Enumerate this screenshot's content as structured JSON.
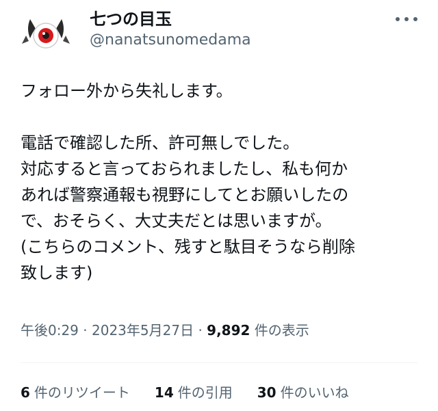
{
  "author": {
    "display_name": "七つの目玉",
    "handle": "@nanatsunomedama",
    "avatar_icon": "red-eyeball-with-horns-icon"
  },
  "tweet": {
    "lines": [
      "フォロー外から失礼します。",
      "",
      "電話で確認した所、許可無しでした。",
      "対応すると言っておられましたし、私も何か",
      "あれば警察通報も視野にしてとお願いしたの",
      "で、おそらく、大丈夫だとは思いますが。",
      "(こちらのコメント、残すと駄目そうなら削除",
      "致します)"
    ]
  },
  "meta": {
    "time": "午後0:29",
    "separator": "·",
    "date": "2023年5月27日",
    "view_count": "9,892",
    "view_label": "件の表示"
  },
  "stats": {
    "retweets_count": "6",
    "retweets_label": "件のリツイート",
    "quotes_count": "14",
    "quotes_label": "件の引用",
    "likes_count": "30",
    "likes_label": "件のいいね"
  },
  "colors": {
    "text_primary": "#0f1419",
    "text_secondary": "#536471",
    "avatar_red": "#d7191c"
  }
}
